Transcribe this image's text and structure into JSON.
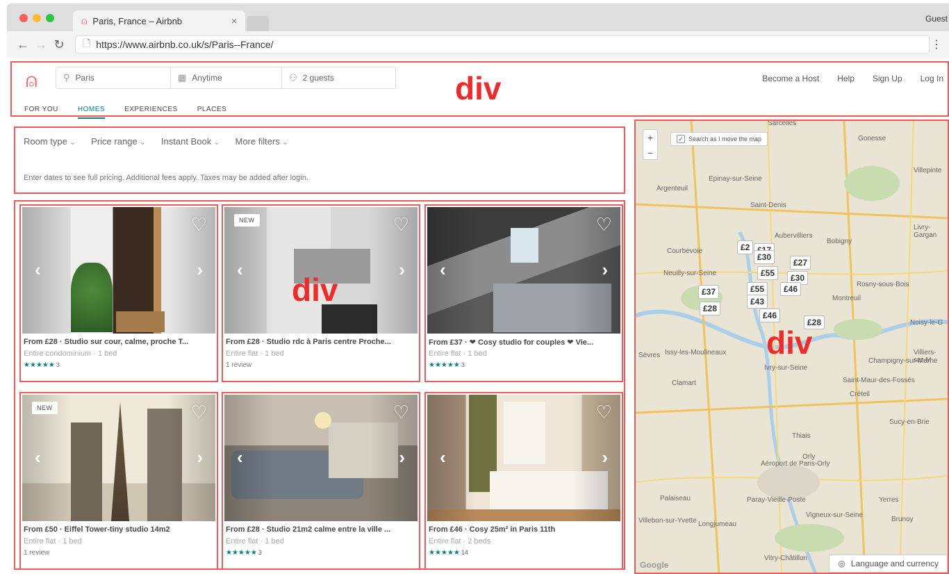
{
  "browser": {
    "tab_title": "Paris, France – Airbnb",
    "profile": "Guest",
    "url": "https://www.airbnb.co.uk/s/Paris--France/"
  },
  "header": {
    "search_location": "Paris",
    "search_dates": "Anytime",
    "search_guests": "2 guests",
    "links": [
      "Become a Host",
      "Help",
      "Sign Up",
      "Log In"
    ],
    "subnav": [
      "FOR YOU",
      "HOMES",
      "EXPERIENCES",
      "PLACES"
    ],
    "active_subnav": "HOMES"
  },
  "annotation_label": "div",
  "filters": {
    "items": [
      "Room type",
      "Price range",
      "Instant Book",
      "More filters"
    ],
    "note": "Enter dates to see full pricing. Additional fees apply. Taxes may be added after login."
  },
  "listings": [
    {
      "title": "From £28 · Studio sur cour, calme, proche T...",
      "sub": "Entire condominium · 1 bed",
      "stars": "★★★★★",
      "count": "3",
      "new": ""
    },
    {
      "title": "From £28 · Studio rdc à Paris centre Proche...",
      "sub": "Entire flat · 1 bed",
      "review": "1 review",
      "new": "NEW"
    },
    {
      "title": "From £37 · ❤ Cosy studio for couples ❤ Vie...",
      "sub": "Entire flat · 1 bed",
      "stars": "★★★★★",
      "count": "3",
      "new": ""
    },
    {
      "title": "From £50 · Eiffel Tower-tiny studio 14m2",
      "sub": "Entire flat · 1 bed",
      "review": "1 review",
      "new": "NEW"
    },
    {
      "title": "From £28 · Studio 21m2 calme entre la ville ...",
      "sub": "Entire flat · 1 bed",
      "stars": "★★★★★",
      "count": "3",
      "new": ""
    },
    {
      "title": "From £46 · Cosy 25m² in Paris 11th",
      "sub": "Entire flat · 2 beds",
      "stars": "★★★★★",
      "count": "14",
      "new": ""
    }
  ],
  "map": {
    "search_move": "Search as I move the map",
    "language": "Language and currency",
    "google": "Google",
    "places": [
      "Sarcelles",
      "Gonesse",
      "Argenteuil",
      "Epinay-sur-Seine",
      "Saint-Denis",
      "Aubervilliers",
      "Bobigny",
      "Courbevoie",
      "Neuilly-sur-Seine",
      "Montreuil",
      "Rosny-sous-Bois",
      "Issy-les-Moulineaux",
      "Ivry-sur-Seine",
      "Clamart",
      "Créteil",
      "Saint-Maur-des-Fossés",
      "Champigny-sur-Marne",
      "Sucy-en-Brie",
      "Thiais",
      "Orly",
      "Aéroport de Paris-Orly",
      "Palaiseau",
      "Longjumeau",
      "Noisy-le-G",
      "Sèvres",
      "Villepinte",
      "Livry-Gargan",
      "Vitry-Châtillon",
      "Yerres",
      "Brunoy",
      "Villebon-sur-Yvette",
      "Paray-Vieille-Poste",
      "Vigneux-sur-Seine",
      "Villiers-sur-M"
    ],
    "prices": [
      "£2",
      "£17",
      "£30",
      "£27",
      "£55",
      "£30",
      "£37",
      "£55",
      "£46",
      "£28",
      "£43",
      "£46",
      "£28"
    ]
  },
  "colors": {
    "brand": "#ff5a5f",
    "teal": "#008489",
    "annotation": "#f25a5a"
  }
}
